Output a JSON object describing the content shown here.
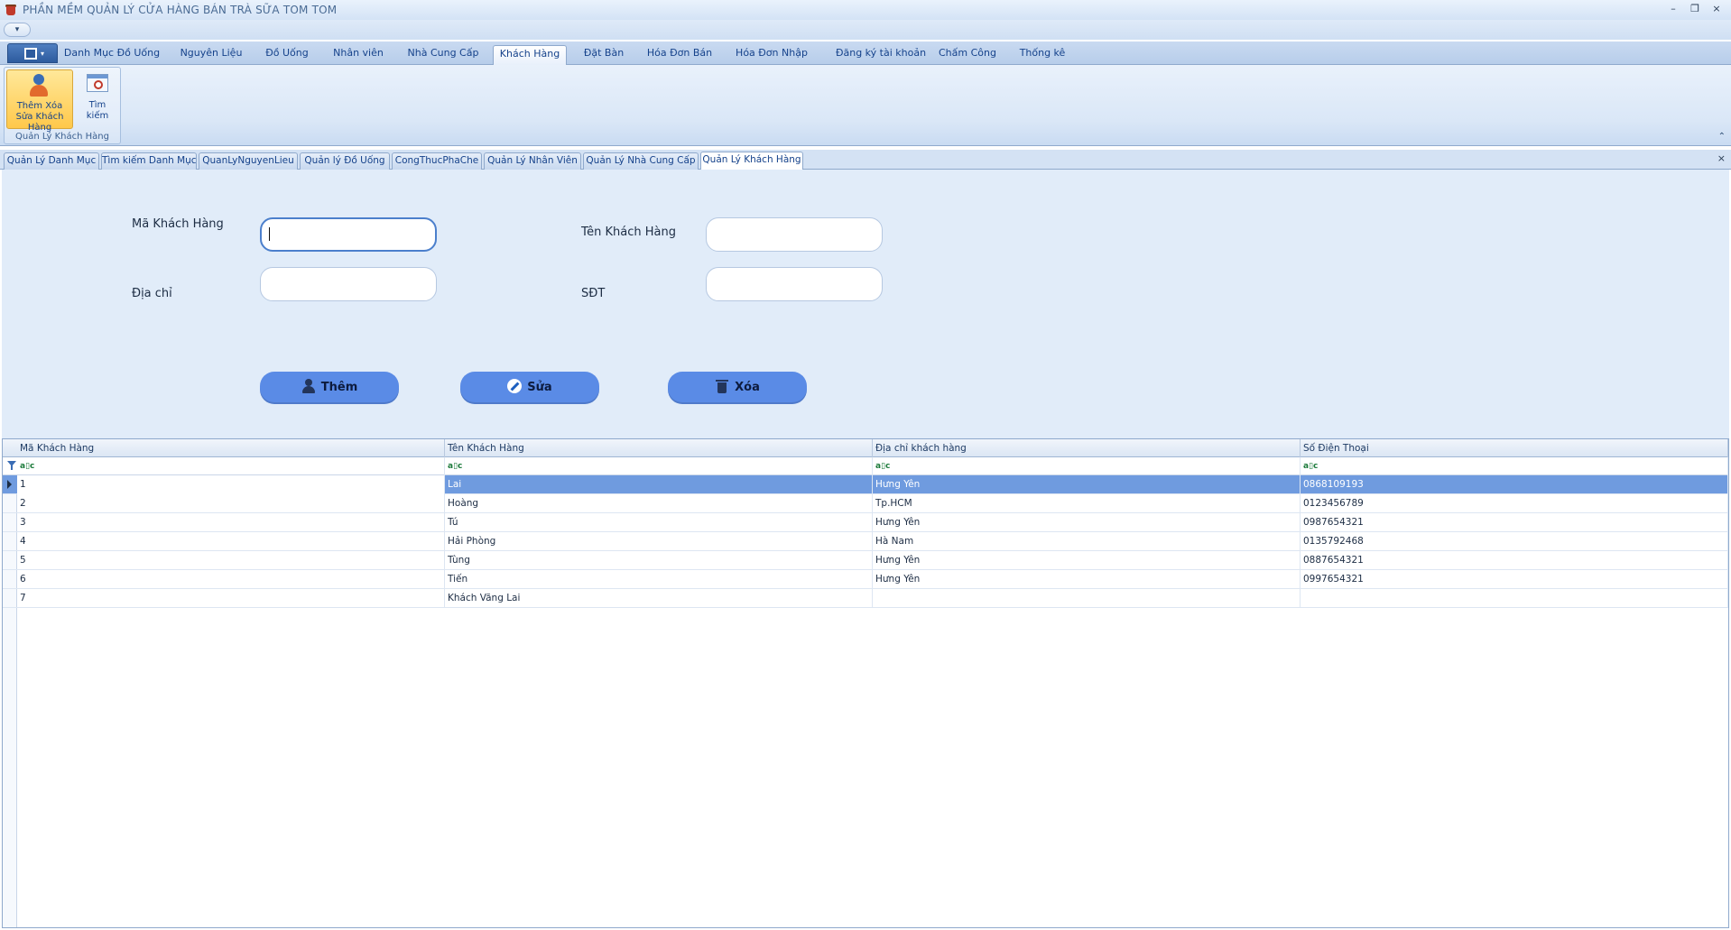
{
  "window": {
    "title": "PHẦN MỀM QUẢN LÝ CỬA HÀNG BÁN TRÀ SỮA TOM TOM",
    "minimize": "–",
    "restore": "❐",
    "close": "×"
  },
  "quick_access": {
    "dropdown": "▾"
  },
  "menu": {
    "app_button_caret": "▾",
    "tabs": [
      {
        "label": "Danh Mục Đồ Uống"
      },
      {
        "label": "Nguyên Liệu"
      },
      {
        "label": "Đồ Uống"
      },
      {
        "label": "Nhân viên"
      },
      {
        "label": "Nhà Cung Cấp"
      },
      {
        "label": "Khách Hàng"
      },
      {
        "label": "Đặt Bàn"
      },
      {
        "label": "Hóa Đơn Bán"
      },
      {
        "label": "Hóa Đơn Nhập"
      },
      {
        "label": "Đăng ký tài khoản"
      },
      {
        "label": "Chấm Công"
      },
      {
        "label": "Thống kê"
      }
    ],
    "active_tab": "Khách Hàng"
  },
  "ribbon": {
    "group_caption": "Quản Lý Khách Hàng",
    "buttons": [
      {
        "label": "Thêm Xóa Sửa Khách Hàng",
        "icon": "customer-icon"
      },
      {
        "label": "Tìm kiếm",
        "icon": "search-window-icon"
      }
    ],
    "collapse_glyph": "⌃"
  },
  "doc_tabs": {
    "tabs": [
      {
        "label": "Quản Lý Danh Mục"
      },
      {
        "label": "Tìm kiếm Danh Mục"
      },
      {
        "label": "QuanLyNguyenLieu"
      },
      {
        "label": "Quản lý Đồ Uống"
      },
      {
        "label": "CongThucPhaChe"
      },
      {
        "label": "Quản Lý Nhân Viên"
      },
      {
        "label": "Quản Lý Nhà Cung Cấp"
      },
      {
        "label": "Quản Lý Khách Hàng"
      }
    ],
    "active_tab": "Quản Lý Khách Hàng",
    "close_glyph": "×"
  },
  "form": {
    "ma_label": "Mã Khách Hàng",
    "ma_value": "",
    "ten_label": "Tên Khách Hàng",
    "ten_value": "",
    "diachi_label": "Địa chỉ",
    "diachi_value": "",
    "sdt_label": "SĐT",
    "sdt_value": "",
    "buttons": {
      "add": "Thêm",
      "edit": "Sửa",
      "delete": "Xóa"
    }
  },
  "grid": {
    "columns": [
      "Mã Khách Hàng",
      "Tên Khách Hàng",
      "Địa chỉ khách hàng",
      "Số Điện Thoại"
    ],
    "filter_glyph": "a▯c",
    "rows": [
      {
        "ma": "1",
        "ten": "Lai",
        "diachi": "Hưng Yên",
        "sdt": "0868109193",
        "selected": true
      },
      {
        "ma": "2",
        "ten": "Hoàng",
        "diachi": "Tp.HCM",
        "sdt": "0123456789"
      },
      {
        "ma": "3",
        "ten": "Tú",
        "diachi": "Hưng Yên",
        "sdt": "0987654321"
      },
      {
        "ma": "4",
        "ten": "Hải Phòng",
        "diachi": "Hà Nam",
        "sdt": "0135792468"
      },
      {
        "ma": "5",
        "ten": "Tùng",
        "diachi": "Hưng Yên",
        "sdt": "0887654321"
      },
      {
        "ma": "6",
        "ten": "Tiến",
        "diachi": "Hưng Yên",
        "sdt": "0997654321"
      },
      {
        "ma": "7",
        "ten": "Khách Vãng Lai",
        "diachi": "",
        "sdt": ""
      }
    ]
  },
  "colors": {
    "selected_row": "#6f9bdf",
    "action_button": "#5a8be6",
    "form_background": "#e1ecf9"
  }
}
